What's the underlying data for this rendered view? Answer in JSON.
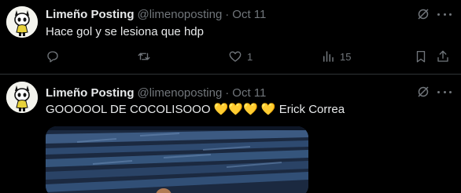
{
  "tweets": [
    {
      "author_name": "Limeño Posting",
      "author_handle": "@limenoposting",
      "separator": "·",
      "date": "Oct 11",
      "text": "Hace gol y se lesiona que hdp",
      "actions": {
        "reply_count": "",
        "retweet_count": "",
        "like_count": "1",
        "views_count": "15"
      }
    },
    {
      "author_name": "Limeño Posting",
      "author_handle": "@limenoposting",
      "separator": "·",
      "date": "Oct 11",
      "text": "GOOOOOL DE COCOLISOOO 💛💛💛 💛 Erick Correa"
    }
  ],
  "icons": {
    "reply": "reply-icon",
    "retweet": "retweet-icon",
    "like": "heart-icon",
    "views": "views-icon",
    "bookmark": "bookmark-icon",
    "share": "share-icon",
    "grok": "grok-icon",
    "more": "more-icon"
  },
  "colors": {
    "background": "#000000",
    "text": "#e7e9ea",
    "muted": "#71767b",
    "divider": "#2f3336",
    "heart_emoji": "#f4c542"
  }
}
